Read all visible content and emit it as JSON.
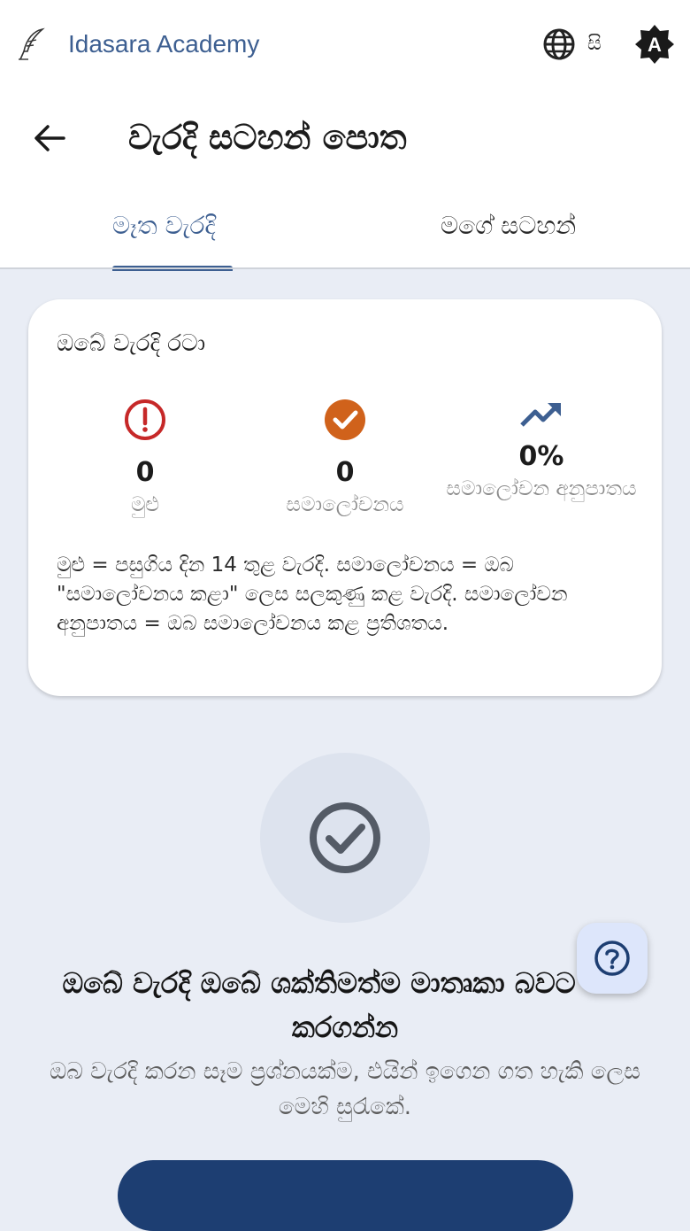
{
  "app": {
    "name": "Idasara Academy",
    "language_code": "සි",
    "brand_color": "#3d5f91"
  },
  "header": {
    "title": "වැරදි සටහන් පොත",
    "back_icon": "arrow-left-icon"
  },
  "tabs": [
    {
      "label": "මෑත වැරදි",
      "active": true
    },
    {
      "label": "මගේ සටහන්",
      "active": false
    }
  ],
  "summary_card": {
    "title": "ඔබේ වැරදි රටා",
    "stats": [
      {
        "icon": "error-circle-icon",
        "value": "0",
        "label": "මුළු",
        "color": "#c62828"
      },
      {
        "icon": "check-circle-icon",
        "value": "0",
        "label": "සමාලෝචනය",
        "color": "#d0621b"
      },
      {
        "icon": "trending-up-icon",
        "value": "0%",
        "label": "සමාලෝචන අනුපාතය",
        "color": "#3d5f91"
      }
    ],
    "note": "මුළු = පසුගිය දින 14 තුළ වැරදි. සමාලෝචනය = ඔබ \"සමාලෝචනය කළා\" ලෙස සලකුණු කළ වැරදි. සමාලෝචන අනුපාතය = ඔබ සමාලෝචනය කළ ප්‍රතිශතය."
  },
  "empty_state": {
    "icon": "check-circle-outline-icon",
    "headline": "ඔබේ වැරදි ඔබේ ශක්තිමත්ම මාතෘකා බවට පත් කරගන්න",
    "subtext": "ඔබ වැරදි කරන සෑම ප්‍රශ්නයක්ම, එයින් ඉගෙන ගත හැකි ලෙස මෙහි සුරැකේ."
  },
  "fab": {
    "icon": "help-circle-icon"
  }
}
